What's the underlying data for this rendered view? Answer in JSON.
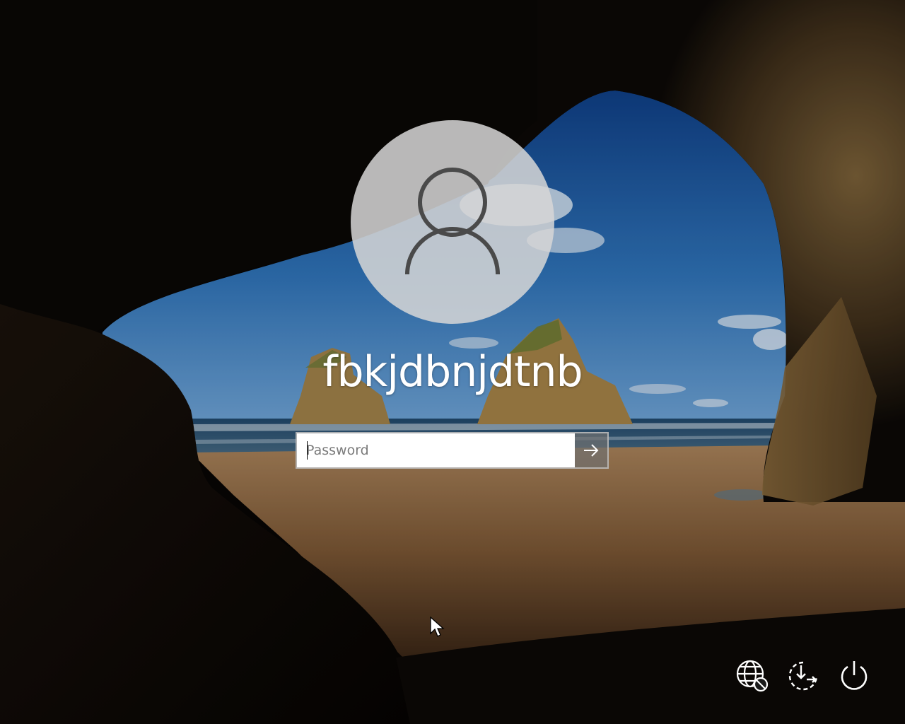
{
  "login": {
    "user_name": "fbkjdbnjdtnb",
    "password_placeholder": "Password",
    "password_value": ""
  },
  "icons": {
    "avatar": "user-silhouette-icon",
    "submit": "arrow-right-icon",
    "network": "globe-network-icon",
    "accessibility": "ease-of-access-icon",
    "power": "power-icon",
    "cursor": "mouse-pointer-icon"
  },
  "colors": {
    "username_text": "#ffffff",
    "input_background": "#ffffff",
    "placeholder_text": "#7a7a7a",
    "avatar_fill": "#d6d6d6",
    "icon_stroke": "#ffffff"
  }
}
